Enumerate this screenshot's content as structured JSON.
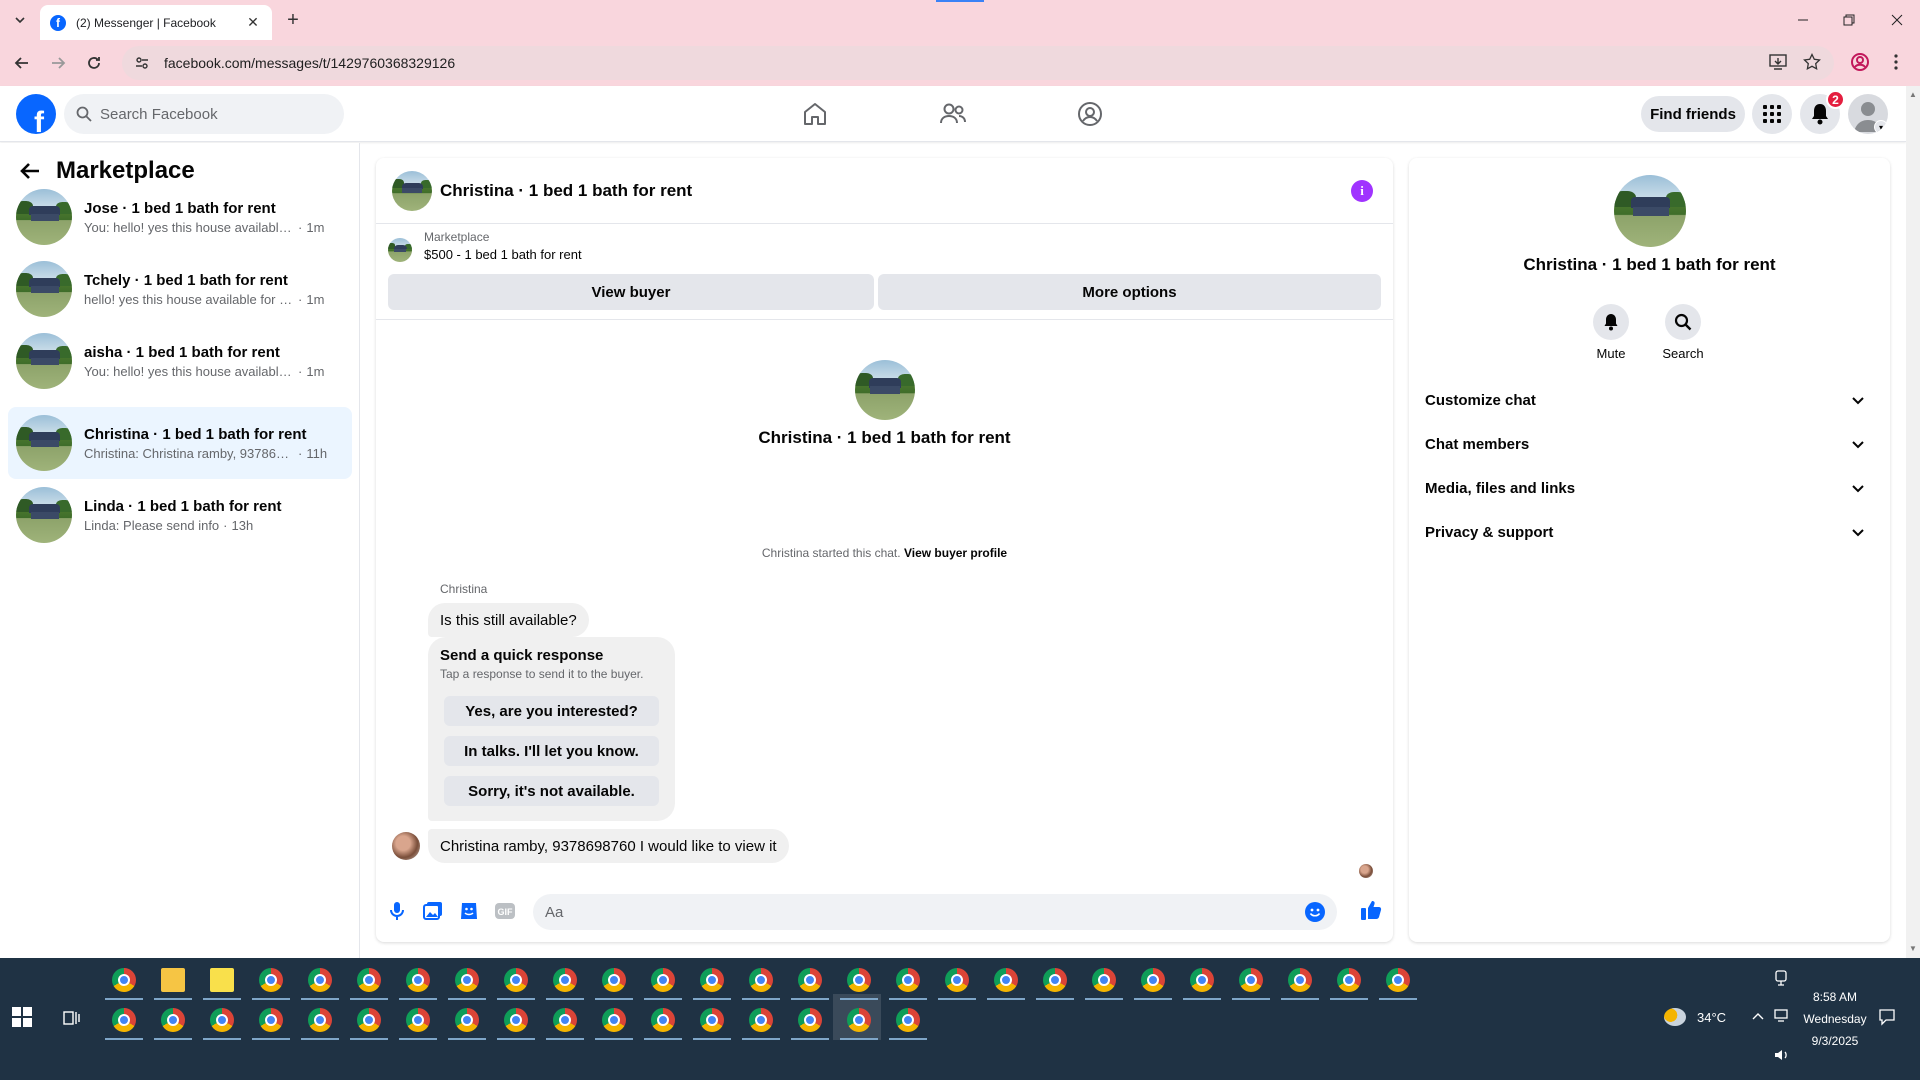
{
  "browser": {
    "tab_title": "(2) Messenger | Facebook",
    "url": "facebook.com/messages/t/1429760368329126"
  },
  "fb_header": {
    "search_placeholder": "Search Facebook",
    "find_friends": "Find friends",
    "notification_count": "2"
  },
  "sidebar": {
    "title": "Marketplace",
    "conversations": [
      {
        "name": "Jose · 1 bed 1 bath for rent",
        "snippet": "You: hello! yes this house available fo...",
        "time": "1m"
      },
      {
        "name": "Tchely · 1 bed 1 bath for rent",
        "snippet": "hello! yes this house available for ren...",
        "time": "1m"
      },
      {
        "name": "aisha · 1 bed 1 bath for rent",
        "snippet": "You: hello! yes this house available fo...",
        "time": "1m"
      },
      {
        "name": "Christina · 1 bed 1 bath for rent",
        "snippet": "Christina: Christina ramby, 93786987...",
        "time": "11h"
      },
      {
        "name": "Linda · 1 bed 1 bath for rent",
        "snippet": "Linda: Please send info",
        "time": "13h"
      }
    ]
  },
  "chat": {
    "title": "Christina · 1 bed 1 bath for rent",
    "listing_label": "Marketplace",
    "listing_price": "$500 - 1 bed 1 bath for rent",
    "view_buyer": "View buyer",
    "more_options": "More options",
    "intro_name": "Christina · 1 bed 1 bath for rent",
    "started_text": "Christina started this chat.",
    "view_buyer_profile": "View buyer profile",
    "sender_name": "Christina",
    "message_1": "Is this still available?",
    "quick_title": "Send a quick response",
    "quick_subtitle": "Tap a response to send it to the buyer.",
    "quick_responses": [
      "Yes, are you interested?",
      "In talks. I'll let you know.",
      "Sorry, it's not available."
    ],
    "message_2": "Christina ramby, 9378698760 I would like to view it",
    "composer_placeholder": "Aa"
  },
  "info_pane": {
    "name": "Christina · 1 bed 1 bath for rent",
    "mute": "Mute",
    "search": "Search",
    "sections": [
      "Customize chat",
      "Chat members",
      "Media, files and links",
      "Privacy & support"
    ]
  },
  "taskbar": {
    "temperature": "34°C",
    "time": "8:58 AM",
    "day": "Wednesday",
    "date": "9/3/2025"
  },
  "colors": {
    "facebook_blue": "#0866ff",
    "chrome_frame": "#f9d6dd",
    "active_conversation": "#ebf5ff",
    "info_purple": "#a033ff",
    "taskbar": "#1f3244"
  }
}
